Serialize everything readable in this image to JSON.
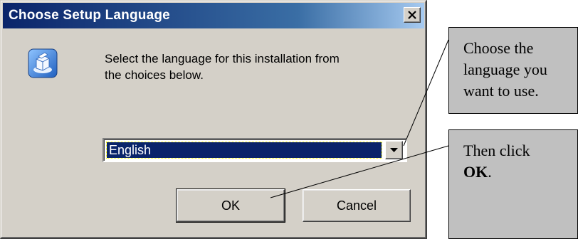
{
  "dialog": {
    "title": "Choose Setup Language",
    "message_line1": "Select the language for this installation from",
    "message_line2": "the choices below.",
    "icons": [
      "close-icon",
      "setup-icon",
      "chevron-down-icon"
    ]
  },
  "language_select": {
    "selected": "English"
  },
  "buttons": {
    "ok": "OK",
    "cancel": "Cancel"
  },
  "callouts": {
    "choose": {
      "line1": "Choose the",
      "line2": "language you",
      "line3": "want to use."
    },
    "click": {
      "line1": "Then click",
      "line2_bold": "OK",
      "line2_rest": "."
    }
  },
  "colors": {
    "titlebar_start": "#0a246a",
    "titlebar_end": "#a6caf0",
    "dialog_face": "#d4d0c8",
    "selection": "#0a246a",
    "callout_fill": "#c0c0c0"
  }
}
